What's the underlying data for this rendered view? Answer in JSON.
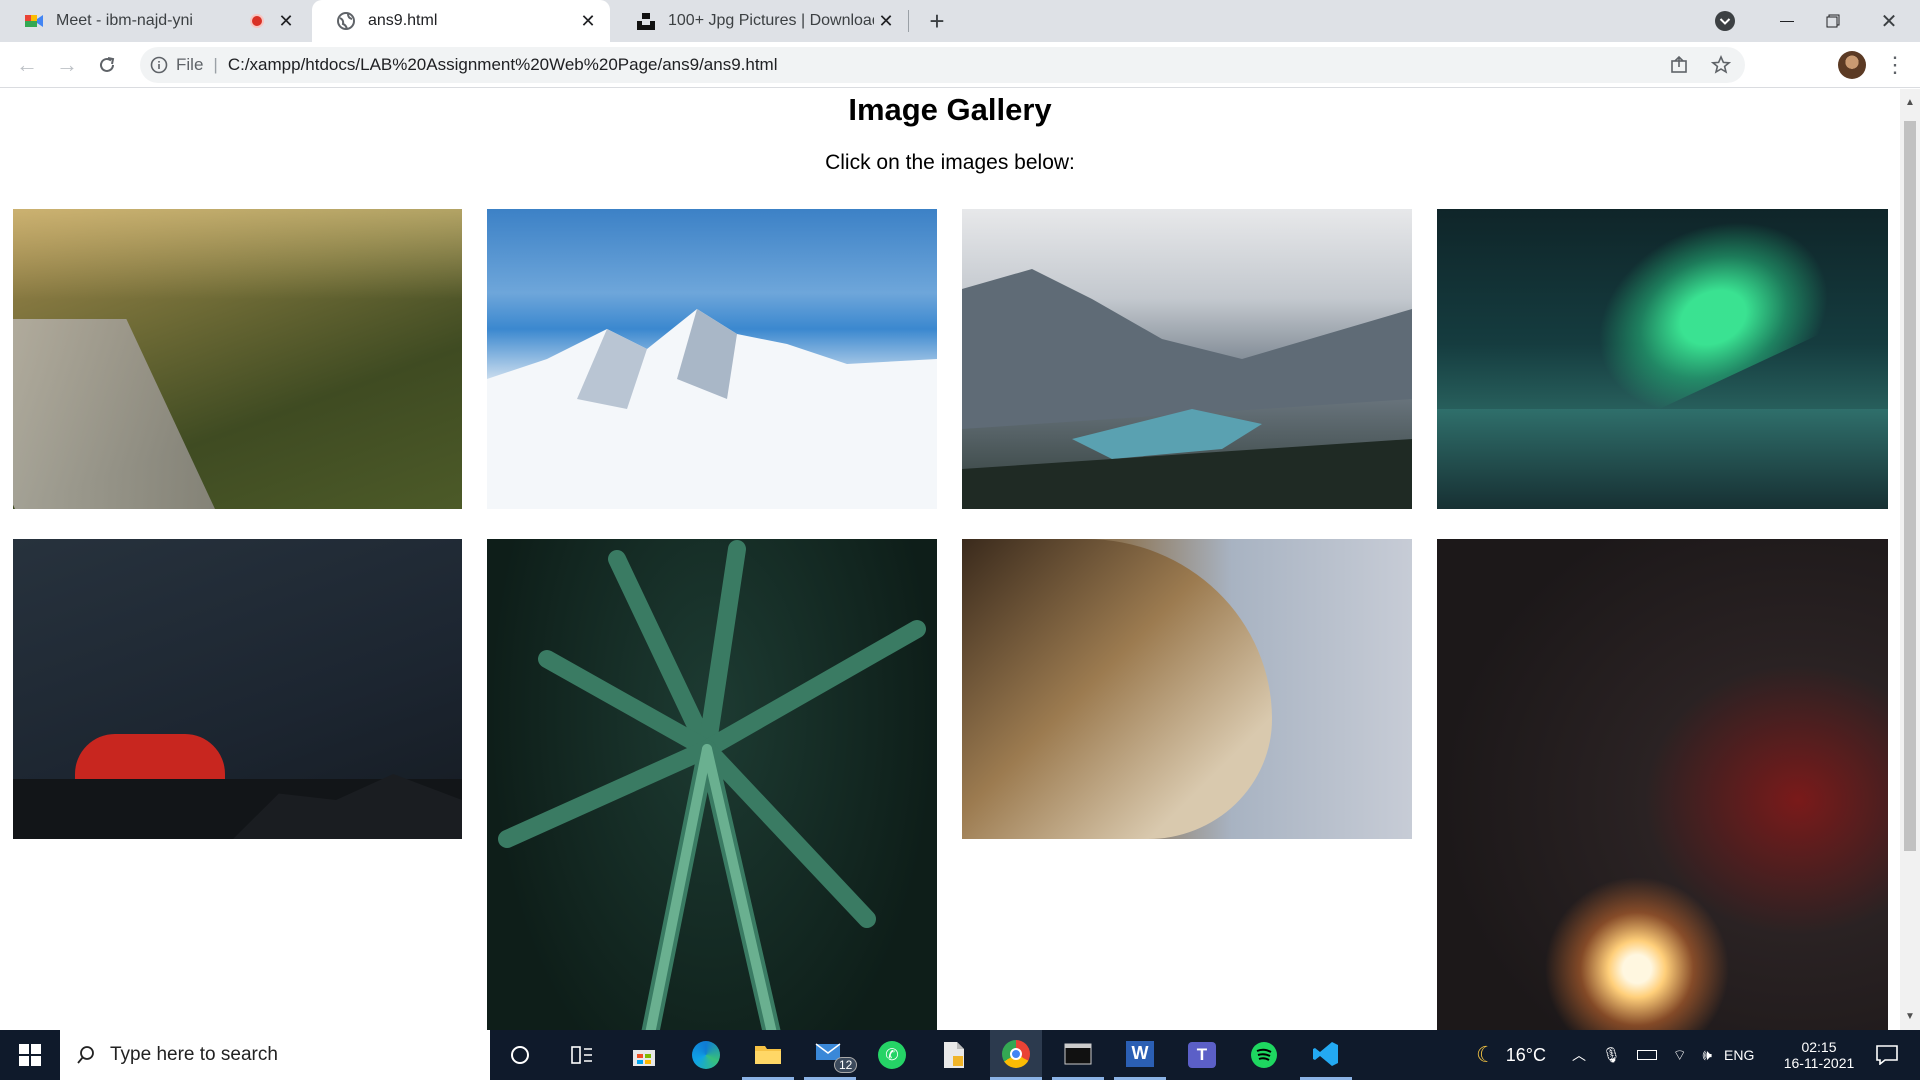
{
  "browser": {
    "tabs": [
      {
        "title": "Meet - ibm-najd-yni",
        "icon": "google-meet-icon",
        "recording": true
      },
      {
        "title": "ans9.html",
        "icon": "globe-icon",
        "active": true
      },
      {
        "title": "100+ Jpg Pictures | Download Fre",
        "icon": "unsplash-icon"
      }
    ],
    "new_tab": "+",
    "url_scheme": "File",
    "url": "C:/xampp/htdocs/LAB%20Assignment%20Web%20Page/ans9/ans9.html"
  },
  "page": {
    "heading": "Image Gallery",
    "subheading": "Click on the images below:",
    "images": [
      {
        "subject": "forest-mountain-sunrise",
        "colors": [
          "#7e6a3e",
          "#5a5e2c",
          "#3d4a22"
        ]
      },
      {
        "subject": "snowy-mountains-blue-sky",
        "colors": [
          "#4e8fd0",
          "#8dbbe4",
          "#eef2f6"
        ]
      },
      {
        "subject": "mountain-lake-valley",
        "colors": [
          "#c9ccd1",
          "#6f7a85",
          "#2f3a35"
        ]
      },
      {
        "subject": "northern-lights",
        "colors": [
          "#0f2e32",
          "#28c87e",
          "#1d4447"
        ]
      },
      {
        "subject": "tent-under-starry-sky",
        "colors": [
          "#1d2630",
          "#2b3846",
          "#c62a26"
        ]
      },
      {
        "subject": "green-plant-with-dew",
        "colors": [
          "#0f211c",
          "#2f5f4c",
          "#56907a"
        ]
      },
      {
        "subject": "tiger-profile",
        "colors": [
          "#8a7250",
          "#b2b8c4",
          "#2b2118"
        ]
      },
      {
        "subject": "sparkler-in-dark",
        "colors": [
          "#1e1a1b",
          "#2e2728",
          "#ffd9a0"
        ]
      }
    ]
  },
  "taskbar": {
    "search_placeholder": "Type here to search",
    "mail_badge": "12",
    "weather": "16°C",
    "language": "ENG",
    "time": "02:15",
    "date": "16-11-2021"
  }
}
